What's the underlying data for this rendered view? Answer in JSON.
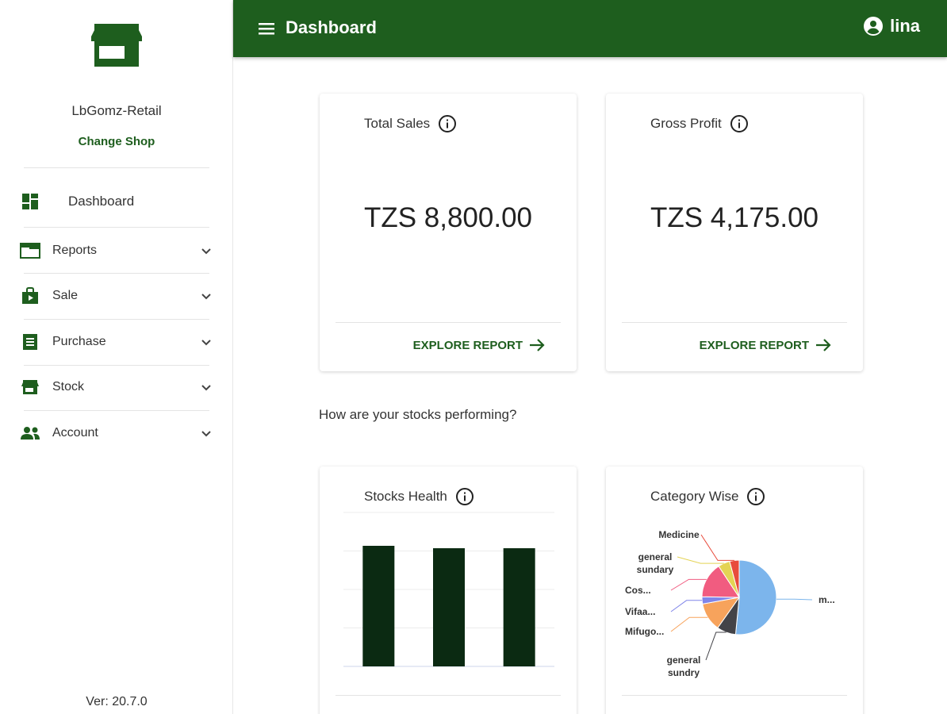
{
  "sidebar": {
    "shop_name": "LbGomz-Retail",
    "change_shop": "Change Shop",
    "items": [
      {
        "label": "Dashboard",
        "icon": "dashboard-icon"
      },
      {
        "label": "Reports",
        "icon": "reports-icon"
      },
      {
        "label": "Sale",
        "icon": "sale-icon"
      },
      {
        "label": "Purchase",
        "icon": "purchase-icon"
      },
      {
        "label": "Stock",
        "icon": "stock-icon"
      },
      {
        "label": "Account",
        "icon": "account-icon"
      }
    ],
    "version": "Ver: 20.7.0"
  },
  "header": {
    "title": "Dashboard",
    "user": "lina"
  },
  "cards": {
    "total_sales": {
      "title": "Total Sales",
      "value": "TZS 8,800.00",
      "action": "EXPLORE REPORT"
    },
    "gross_profit": {
      "title": "Gross Profit",
      "value": "TZS 4,175.00",
      "action": "EXPLORE REPORT"
    },
    "stocks_health": {
      "title": "Stocks Health"
    },
    "category_wise": {
      "title": "Category Wise"
    }
  },
  "stocks_question": "How are your stocks performing?",
  "colors": {
    "primary": "#1e5e1e",
    "bar": "#0b2a12"
  },
  "chart_data": [
    {
      "type": "bar",
      "title": "Stocks Health",
      "categories": [
        "",
        "",
        ""
      ],
      "values": [
        100,
        98,
        98
      ],
      "ylim": [
        0,
        100
      ],
      "grid": true
    },
    {
      "type": "pie",
      "title": "Category Wise",
      "labels": [
        "m...",
        "general sundry",
        "Mifugo...",
        "Vifaa...",
        "Cos...",
        "general sundary",
        "Medicine"
      ],
      "values": [
        50,
        8,
        12,
        3,
        15,
        5,
        4
      ],
      "colors": [
        "#7cb5ec",
        "#434348",
        "#f7a35c",
        "#8085e9",
        "#f15c80",
        "#e4d354",
        "#e84b3c"
      ]
    }
  ]
}
